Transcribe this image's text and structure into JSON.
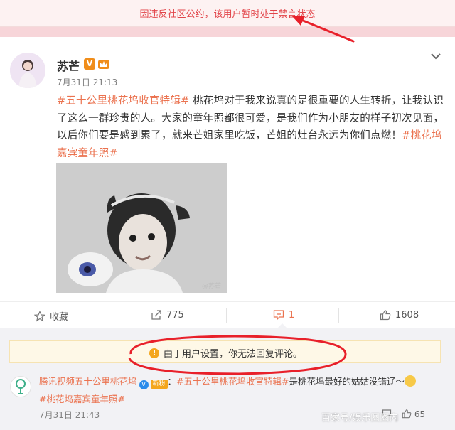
{
  "notice": {
    "text": "因违反社区公约，该用户暂时处于禁言状态"
  },
  "post": {
    "username": "苏芒",
    "vip_badge": "V",
    "timestamp": "7月31日 21:13",
    "tag1": "#五十公里桃花坞收官特辑#",
    "body": " 桃花坞对于我来说真的是很重要的人生转折，让我认识了这么一群珍贵的人。大家的童年照都很可爱，是我们作为小朋友的样子初次见面，以后你们要是感到累了，就来芒姐家里吃饭，芒姐的灶台永远为你们点燃！",
    "tag2": "#桃花坞嘉宾童年照#",
    "photo_watermark": "@苏芒"
  },
  "actions": {
    "favorite": "收藏",
    "repost": "775",
    "comment": "1",
    "like": "1608"
  },
  "restriction": {
    "text": "由于用户设置，你无法回复评论。"
  },
  "comment": {
    "author": "腾讯视频五十公里桃花坞",
    "level_badge": "新粉",
    "tag": "#五十公里桃花坞收官特辑#",
    "text": "是桃花坞最好的姑姑没错辽～",
    "line2_tag": "#桃花坞嘉宾童年照#",
    "time": "7月31日 21:43",
    "reply_icon": "reply-icon",
    "like_count": "65"
  },
  "watermark": "百家号/娱乐圈圈内",
  "colors": {
    "accent": "#eb7350",
    "notice_red": "#e2454a",
    "annotation_red": "#e8202a"
  }
}
